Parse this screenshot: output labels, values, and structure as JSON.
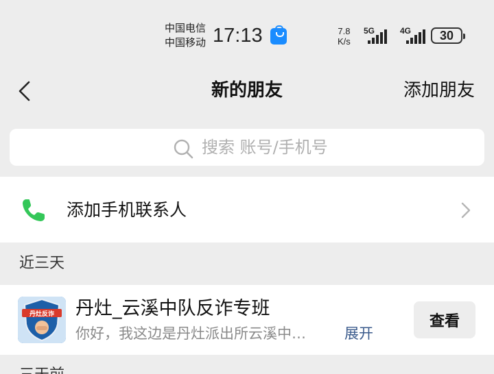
{
  "status_bar": {
    "carrier_1": "中国电信",
    "carrier_2": "中国移动",
    "time": "17:13",
    "net_speed_value": "7.8",
    "net_speed_unit": "K/s",
    "network_1": "5G",
    "network_2": "4G",
    "battery": "30",
    "icons": [
      "shopping-bag-icon",
      "signal-5g-icon",
      "signal-4g-icon",
      "battery-icon"
    ]
  },
  "navbar": {
    "title": "新的朋友",
    "right_action": "添加朋友"
  },
  "search": {
    "placeholder": "搜索 账号/手机号",
    "value": ""
  },
  "phone_contacts": {
    "label": "添加手机联系人"
  },
  "sections": [
    {
      "header": "近三天",
      "items": [
        {
          "name": "丹灶_云溪中队反诈专班",
          "message": "你好，我这边是丹灶派出所云溪中…",
          "expand_label": "展开",
          "action_label": "查看"
        }
      ]
    },
    {
      "header": "三天前"
    }
  ],
  "colors": {
    "page_bg": "#ededed",
    "phone_icon": "#34c759",
    "expand_link": "#3b5b8c",
    "bag_icon": "#1a8cff"
  }
}
